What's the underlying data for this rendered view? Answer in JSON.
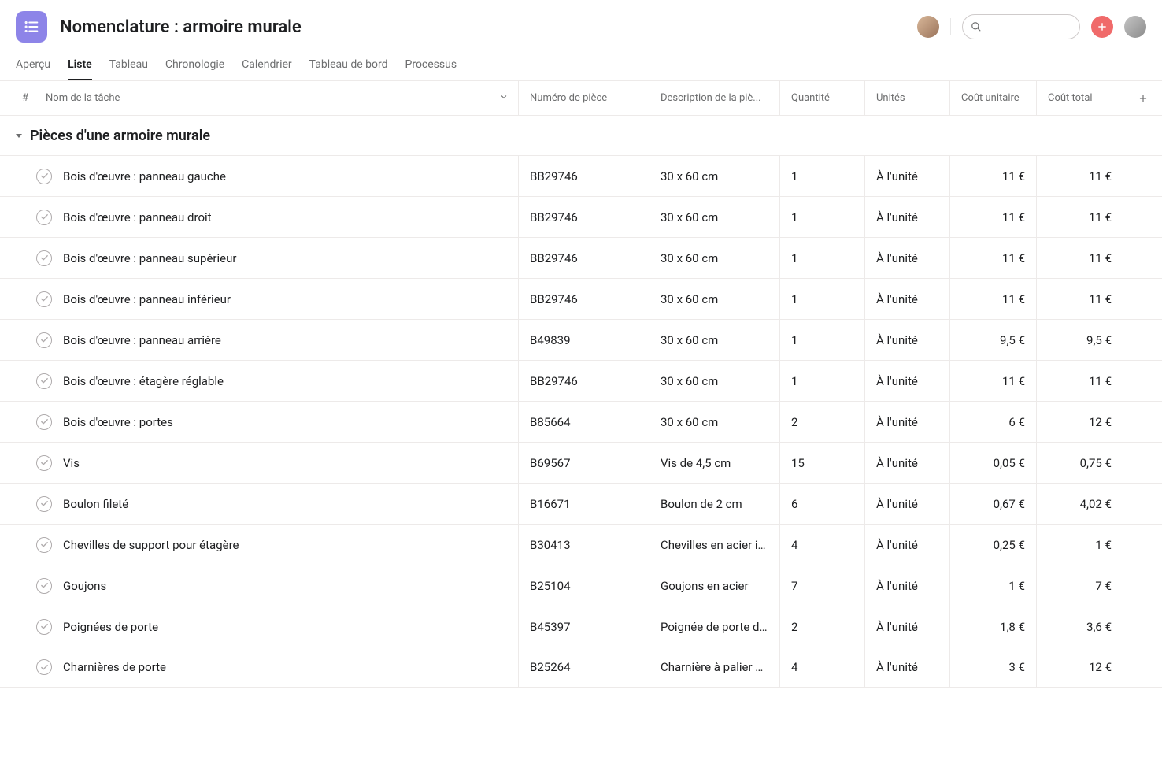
{
  "header": {
    "title": "Nomenclature : armoire murale",
    "search_placeholder": ""
  },
  "tabs": [
    {
      "label": "Aperçu",
      "active": false
    },
    {
      "label": "Liste",
      "active": true
    },
    {
      "label": "Tableau",
      "active": false
    },
    {
      "label": "Chronologie",
      "active": false
    },
    {
      "label": "Calendrier",
      "active": false
    },
    {
      "label": "Tableau de bord",
      "active": false
    },
    {
      "label": "Processus",
      "active": false
    }
  ],
  "columns": {
    "hash": "#",
    "task": "Nom de la tâche",
    "part": "Numéro de pièce",
    "desc": "Description de la piè...",
    "qty": "Quantité",
    "units": "Unités",
    "ucost": "Coût unitaire",
    "tcost": "Coût total"
  },
  "section": {
    "title": "Pièces d'une armoire murale"
  },
  "rows": [
    {
      "task": "Bois d'œuvre : panneau gauche",
      "part": "BB29746",
      "desc": "30 x 60 cm",
      "qty": "1",
      "unit": "À l'unité",
      "ucost": "11 €",
      "tcost": "11 €"
    },
    {
      "task": "Bois d'œuvre : panneau droit",
      "part": "BB29746",
      "desc": "30 x 60 cm",
      "qty": "1",
      "unit": "À l'unité",
      "ucost": "11 €",
      "tcost": "11 €"
    },
    {
      "task": "Bois d'œuvre : panneau supérieur",
      "part": "BB29746",
      "desc": "30 x 60 cm",
      "qty": "1",
      "unit": "À l'unité",
      "ucost": "11 €",
      "tcost": "11 €"
    },
    {
      "task": "Bois d'œuvre : panneau inférieur",
      "part": "BB29746",
      "desc": "30 x 60 cm",
      "qty": "1",
      "unit": "À l'unité",
      "ucost": "11 €",
      "tcost": "11 €"
    },
    {
      "task": "Bois d'œuvre : panneau arrière",
      "part": "B49839",
      "desc": "30 x 60 cm",
      "qty": "1",
      "unit": "À l'unité",
      "ucost": "9,5 €",
      "tcost": "9,5 €"
    },
    {
      "task": "Bois d'œuvre : étagère réglable",
      "part": "BB29746",
      "desc": "30 x 60 cm",
      "qty": "1",
      "unit": "À l'unité",
      "ucost": "11 €",
      "tcost": "11 €"
    },
    {
      "task": "Bois d'œuvre : portes",
      "part": "B85664",
      "desc": "30 x 60 cm",
      "qty": "2",
      "unit": "À l'unité",
      "ucost": "6 €",
      "tcost": "12 €"
    },
    {
      "task": "Vis",
      "part": "B69567",
      "desc": "Vis de 4,5 cm",
      "qty": "15",
      "unit": "À l'unité",
      "ucost": "0,05 €",
      "tcost": "0,75 €"
    },
    {
      "task": "Boulon fileté",
      "part": "B16671",
      "desc": "Boulon de 2 cm",
      "qty": "6",
      "unit": "À l'unité",
      "ucost": "0,67 €",
      "tcost": "4,02 €"
    },
    {
      "task": "Chevilles de support pour étagère",
      "part": "B30413",
      "desc": "Chevilles en acier in...",
      "qty": "4",
      "unit": "À l'unité",
      "ucost": "0,25 €",
      "tcost": "1 €"
    },
    {
      "task": "Goujons",
      "part": "B25104",
      "desc": "Goujons en acier",
      "qty": "7",
      "unit": "À l'unité",
      "ucost": "1 €",
      "tcost": "7 €"
    },
    {
      "task": "Poignées de porte",
      "part": "B45397",
      "desc": "Poignée de porte d'i...",
      "qty": "2",
      "unit": "À l'unité",
      "ucost": "1,8 €",
      "tcost": "3,6 €"
    },
    {
      "task": "Charnières de porte",
      "part": "B25264",
      "desc": "Charnière à palier d...",
      "qty": "4",
      "unit": "À l'unité",
      "ucost": "3 €",
      "tcost": "12 €"
    }
  ]
}
